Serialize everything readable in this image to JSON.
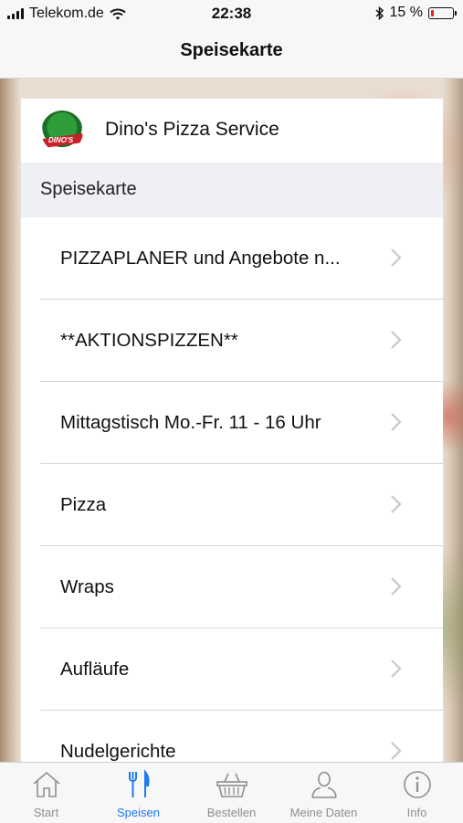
{
  "status_bar": {
    "carrier": "Telekom.de",
    "time": "22:38",
    "battery_percent_label": "15 %",
    "battery_level": 0.15,
    "battery_color": "#e0242b",
    "icons": [
      "signal-icon",
      "wifi-icon",
      "bluetooth-icon",
      "battery-icon"
    ]
  },
  "nav": {
    "title": "Speisekarte"
  },
  "restaurant": {
    "name": "Dino's Pizza Service",
    "logo_text": "DINO'S"
  },
  "section_header": "Speisekarte",
  "menu_items": [
    {
      "label": "PIZZAPLANER und Angebote n..."
    },
    {
      "label": "**AKTIONSPIZZEN**"
    },
    {
      "label": "Mittagstisch Mo.-Fr. 11 - 16 Uhr"
    },
    {
      "label": "Pizza"
    },
    {
      "label": "Wraps"
    },
    {
      "label": "Aufläufe"
    },
    {
      "label": "Nudelgerichte"
    }
  ],
  "tabs": [
    {
      "label": "Start",
      "icon": "home-icon",
      "active": false
    },
    {
      "label": "Speisen",
      "icon": "fork-knife-icon",
      "active": true
    },
    {
      "label": "Bestellen",
      "icon": "basket-icon",
      "active": false
    },
    {
      "label": "Meine Daten",
      "icon": "person-icon",
      "active": false
    },
    {
      "label": "Info",
      "icon": "info-icon",
      "active": false
    }
  ],
  "colors": {
    "accent": "#1a7cf2",
    "inactive": "#8e8e93"
  }
}
